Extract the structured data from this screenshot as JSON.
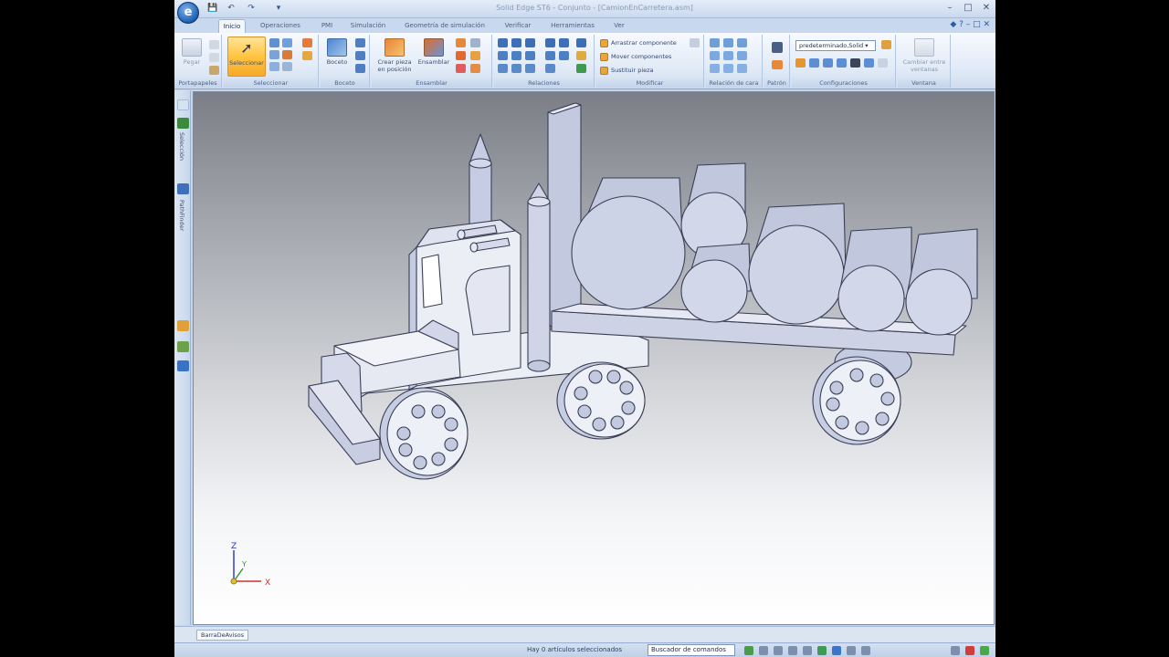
{
  "window": {
    "title": "Solid Edge ST6 - Conjunto - [CamionEnCarretera.asm]",
    "logo_text": "e",
    "minimize": "–",
    "maximize": "□",
    "close": "✕"
  },
  "quick_access": [
    "💾",
    "↶",
    "↷",
    "▾"
  ],
  "tabs": [
    {
      "label": "Inicio",
      "active": true
    },
    {
      "label": "Operaciones"
    },
    {
      "label": "PMI"
    },
    {
      "label": "Simulación"
    },
    {
      "label": "Geometría de simulación"
    },
    {
      "label": "Verificar"
    },
    {
      "label": "Herramientas"
    },
    {
      "label": "Ver"
    }
  ],
  "help_icons": "◆ ? – □ ✕",
  "ribbon": {
    "groups": [
      {
        "label": "Portapapeles"
      },
      {
        "label": "Seleccionar"
      },
      {
        "label": "Boceto"
      },
      {
        "label": "Ensamblar"
      },
      {
        "label": "Relaciones"
      },
      {
        "label": "Modificar"
      },
      {
        "label": "Relación de cara"
      },
      {
        "label": "Patrón"
      },
      {
        "label": "Configuraciones"
      },
      {
        "label": "Ventana"
      }
    ],
    "pegar": "Pegar",
    "seleccionar": "Seleccionar",
    "boceto": "Boceto",
    "crear_pieza": "Crear pieza",
    "en_posicion": "en posición",
    "ensamblar": "Ensamblar",
    "arrastrar": "Arrastrar componente",
    "mover": "Mover componentes",
    "sustituir": "Sustituir pieza",
    "config_value": "predeterminado,Solid",
    "cambiar": "Cambiar entre",
    "ventanas": "ventanas"
  },
  "leftbar": {
    "selection_tab": "Selección",
    "pathfinder_tab": "PathFinder"
  },
  "triad": {
    "z": "Z",
    "y": "Y",
    "x": "X"
  },
  "bottom": {
    "bar_tab": "BarraDeAvisos",
    "status": "Hay 0 artículos seleccionados",
    "command_finder": "Buscador de comandos"
  },
  "colors": {
    "accent": "#f7a92a",
    "ribbon_bg": "#dfe9f6",
    "part_fill": "#c9cfe6",
    "part_stroke": "#3a3f55"
  }
}
